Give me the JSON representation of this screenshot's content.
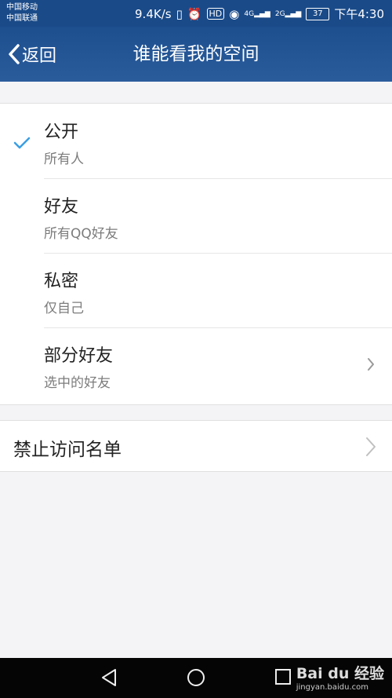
{
  "status": {
    "carrier1": "中国移动",
    "carrier2": "中国联通",
    "speed": "9.4K/s",
    "hd": "HD",
    "net4g": "4G",
    "net2g": "2G",
    "battery": "37",
    "time": "下午4:30"
  },
  "header": {
    "back_label": "返回",
    "title": "谁能看我的空间"
  },
  "options": [
    {
      "title": "公开",
      "subtitle": "所有人",
      "selected": true
    },
    {
      "title": "好友",
      "subtitle": "所有QQ好友",
      "selected": false
    },
    {
      "title": "私密",
      "subtitle": "仅自己",
      "selected": false
    },
    {
      "title": "部分好友",
      "subtitle": "选中的好友",
      "selected": false
    }
  ],
  "block_list": {
    "label": "禁止访问名单"
  },
  "watermark": {
    "brand": "Bai du 经验",
    "url": "jingyan.baidu.com"
  },
  "colors": {
    "accent": "#3a9ee4",
    "header": "#1d4f8f"
  }
}
